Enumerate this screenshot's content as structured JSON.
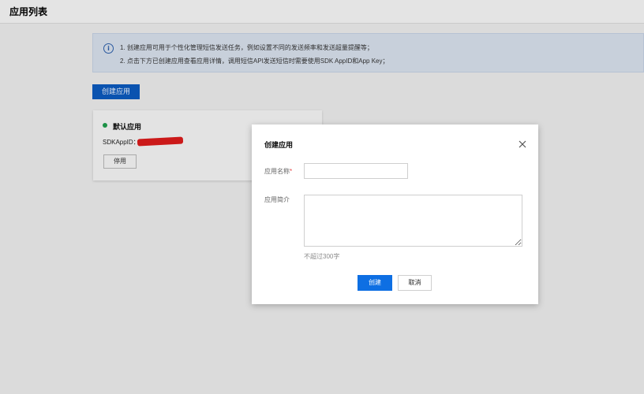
{
  "page": {
    "title": "应用列表"
  },
  "info": {
    "line1": "1. 创建应用可用于个性化管理短信发送任务，例如设置不同的发送频率和发送超量提醒等；",
    "line2": "2. 点击下方已创建应用查看应用详情，调用短信API发送短信时需要使用SDK AppID和App Key；",
    "icon": "info-icon"
  },
  "toolbar": {
    "create_label": "创建应用"
  },
  "app_card": {
    "name": "默认应用",
    "status_color": "#1e9b4b",
    "sdk_label": "SDKAppID：",
    "disable_label": "停用"
  },
  "dialog": {
    "title": "创建应用",
    "name_label": "应用名称",
    "required_mark": "*",
    "desc_label": "应用简介",
    "name_value": "",
    "desc_value": "",
    "hint": "不超过300字",
    "ok_label": "创建",
    "cancel_label": "取消"
  },
  "colors": {
    "primary": "#0e6fe3",
    "header_button": "#0b59bb",
    "required": "#e54545"
  }
}
